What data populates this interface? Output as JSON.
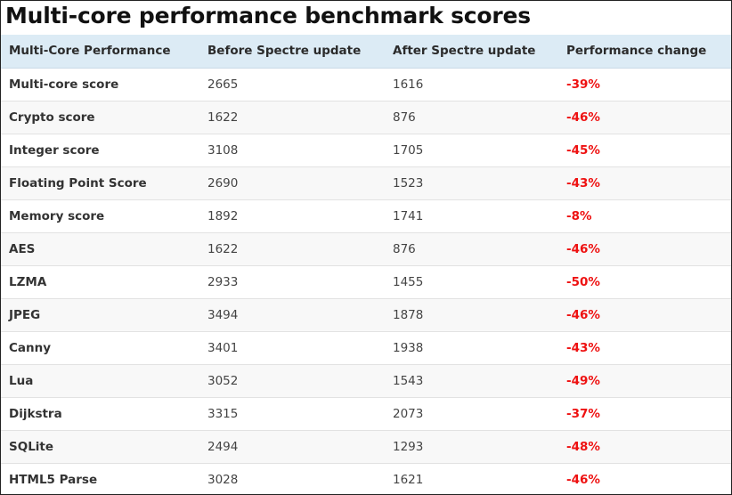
{
  "title": "Multi-core performance benchmark scores",
  "table": {
    "headers": [
      "Multi-Core Performance",
      "Before Spectre update",
      "After Spectre update",
      "Performance change"
    ],
    "rows": [
      [
        "Multi-core score",
        "2665",
        "1616",
        "-39%"
      ],
      [
        "Crypto score",
        "1622",
        "876",
        "-46%"
      ],
      [
        "Integer score",
        "3108",
        "1705",
        "-45%"
      ],
      [
        "Floating Point Score",
        "2690",
        "1523",
        "-43%"
      ],
      [
        "Memory score",
        "1892",
        "1741",
        "-8%"
      ],
      [
        "AES",
        "1622",
        "876",
        "-46%"
      ],
      [
        "LZMA",
        "2933",
        "1455",
        "-50%"
      ],
      [
        "JPEG",
        "3494",
        "1878",
        "-46%"
      ],
      [
        "Canny",
        "3401",
        "1938",
        "-43%"
      ],
      [
        "Lua",
        "3052",
        "1543",
        "-49%"
      ],
      [
        "Dijkstra",
        "3315",
        "2073",
        "-37%"
      ],
      [
        "SQLite",
        "2494",
        "1293",
        "-48%"
      ],
      [
        "HTML5 Parse",
        "3028",
        "1621",
        "-46%"
      ]
    ]
  },
  "colors": {
    "header_bg": "#dcebf5",
    "negative_change": "#ee1111",
    "row_alt": "#f8f8f8"
  }
}
